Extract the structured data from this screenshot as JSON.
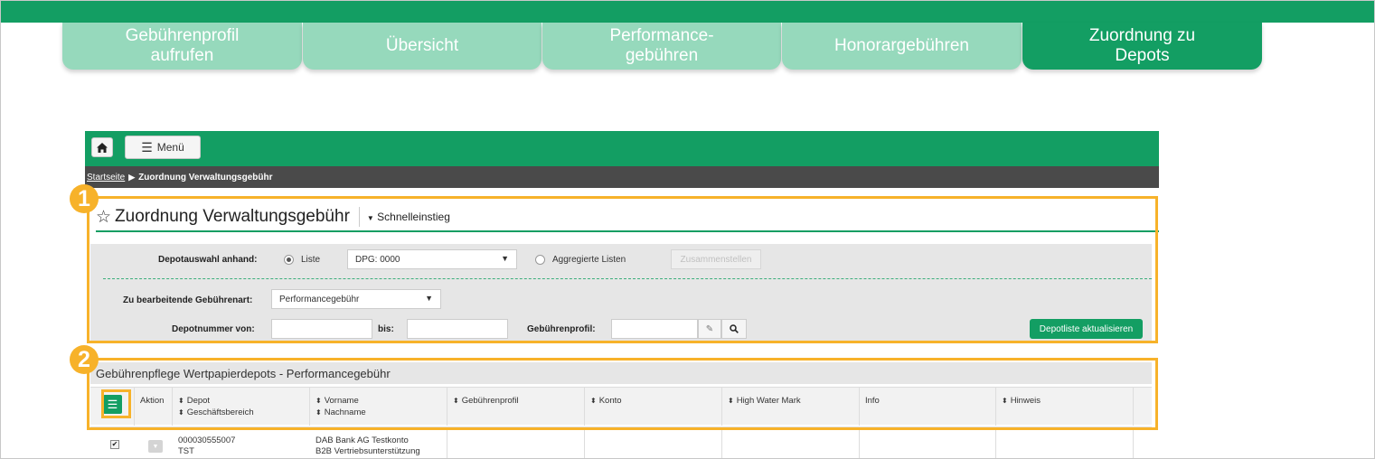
{
  "tabs": [
    {
      "line1": "Gebührenprofil",
      "line2": "aufrufen",
      "active": false
    },
    {
      "line1": "Übersicht",
      "line2": "",
      "active": false
    },
    {
      "line1": "Performance-",
      "line2": "gebühren",
      "active": false
    },
    {
      "line1": "Honorargebühren",
      "line2": "",
      "active": false
    },
    {
      "line1": "Zuordnung zu",
      "line2": "Depots",
      "active": true
    }
  ],
  "app": {
    "home_icon": "home-icon",
    "menu_label": "Menü",
    "breadcrumb": {
      "home": "Startseite",
      "current": "Zuordnung Verwaltungsgebühr"
    },
    "page_title": "Zuordnung Verwaltungsgebühr",
    "quick_access": "Schnelleinstieg",
    "filter": {
      "depot_select_label": "Depotauswahl anhand:",
      "radio_list": "Liste",
      "list_value": "DPG: 0000",
      "radio_aggregated": "Aggregierte Listen",
      "combine_button": "Zusammenstellen",
      "fee_type_label": "Zu bearbeitende Gebührenart:",
      "fee_type_value": "Performancegebühr",
      "depot_from_label": "Depotnummer von:",
      "depot_to_label": "bis:",
      "fee_profile_label": "Gebührenprofil:",
      "refresh_button": "Depotliste aktualisieren"
    },
    "grid": {
      "title": "Gebührenpflege Wertpapierdepots - Performancegebühr",
      "columns": {
        "aktion": "Aktion",
        "depot": "Depot",
        "geschaeftsbereich": "Geschäftsbereich",
        "vorname": "Vorname",
        "nachname": "Nachname",
        "gebuehrenprofil": "Gebührenprofil",
        "konto": "Konto",
        "hwm": "High Water Mark",
        "info": "Info",
        "hinweis": "Hinweis"
      },
      "rows": [
        {
          "depot": "000030555007",
          "bereich": "TST",
          "name1": "DAB Bank AG Testkonto",
          "name2": "B2B Vertriebsunterstützung"
        }
      ]
    }
  },
  "callouts": [
    "1",
    "2"
  ],
  "colors": {
    "brand_green": "#139e63",
    "tab_light": "#96d9bc",
    "highlight": "#f7b22a"
  }
}
